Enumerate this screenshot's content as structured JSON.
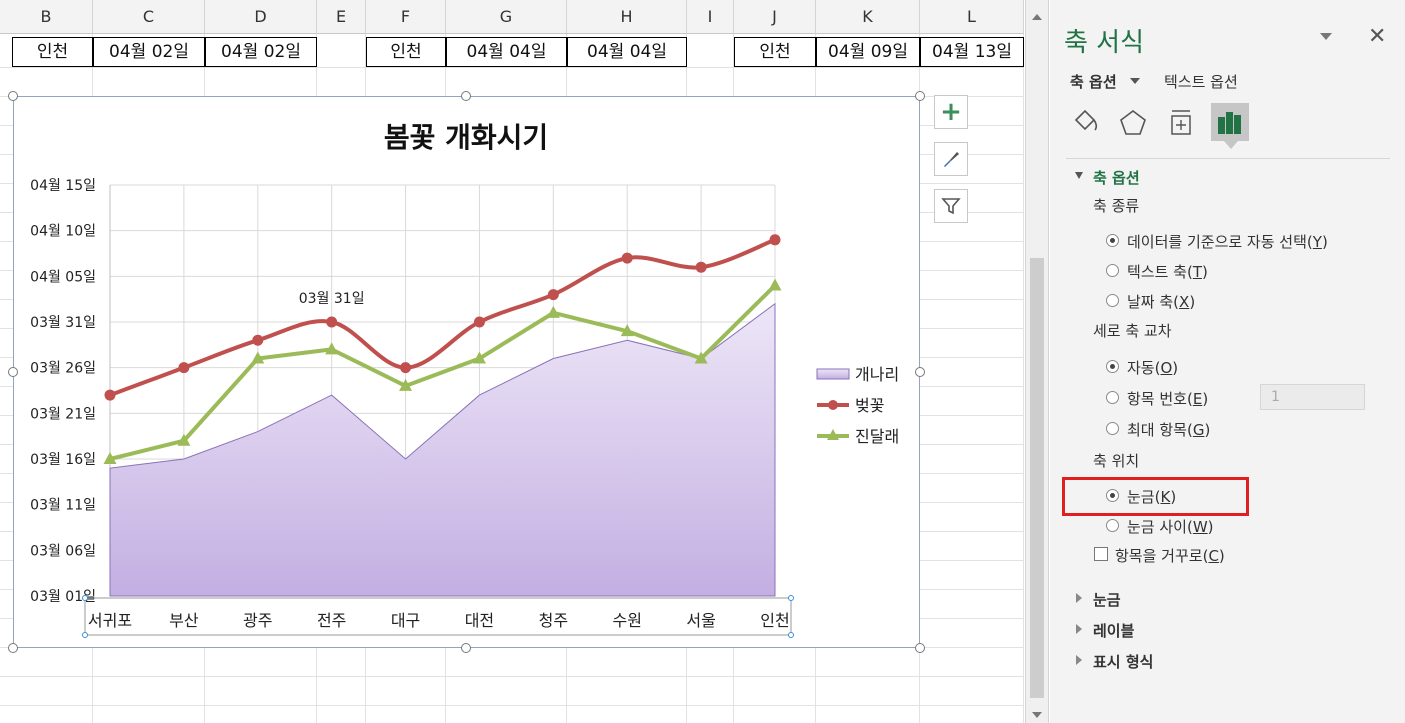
{
  "sheet": {
    "columns": [
      "B",
      "C",
      "D",
      "E",
      "F",
      "G",
      "H",
      "I",
      "J",
      "K",
      "L"
    ],
    "row_cells": [
      "인천",
      "04월 02일",
      "04월 02일",
      "",
      "인천",
      "04월 04일",
      "04월 04일",
      "",
      "인천",
      "04월 09일",
      "04월 13일"
    ]
  },
  "chart_data": {
    "type": "line",
    "title": "봄꽃 개화시기",
    "categories": [
      "서귀포",
      "부산",
      "광주",
      "전주",
      "대구",
      "대전",
      "청주",
      "수원",
      "서울",
      "인천"
    ],
    "y_tick_labels": [
      "04월 15일",
      "04월 10일",
      "04월 05일",
      "03월 31일",
      "03월 26일",
      "03월 21일",
      "03월 16일",
      "03월 11일",
      "03월 06일",
      "03월 01일"
    ],
    "ylim_day_of_march": [
      1,
      46
    ],
    "series": [
      {
        "name": "개나리",
        "kind": "area",
        "values_day_of_march": [
          15,
          16,
          19,
          23,
          16,
          23,
          27,
          29,
          27,
          33
        ],
        "color": "#c6b4e4"
      },
      {
        "name": "벚꽃",
        "kind": "line",
        "marker": "circle",
        "values_day_of_march": [
          23,
          26,
          29,
          31,
          26,
          31,
          34,
          38,
          37,
          40
        ],
        "color": "#c0504d"
      },
      {
        "name": "진달래",
        "kind": "line",
        "marker": "triangle",
        "values_day_of_march": [
          16,
          18,
          27,
          28,
          24,
          27,
          32,
          30,
          27,
          35
        ],
        "color": "#9bbb59"
      }
    ],
    "data_label": {
      "series": "벚꽃",
      "index": 3,
      "text": "03월 31일"
    },
    "grid": true,
    "legend": "right"
  },
  "pane": {
    "title": "축 서식",
    "tab_axis_options": "축 옵션",
    "tab_text_options": "텍스트 옵션",
    "section_axis_options": "축 옵션",
    "axis_type": {
      "label": "축 종류",
      "options": [
        {
          "text": "데이터를 기준으로 자동 선택",
          "key": "Y",
          "selected": true
        },
        {
          "text": "텍스트 축",
          "key": "T",
          "selected": false
        },
        {
          "text": "날짜 축",
          "key": "X",
          "selected": false
        }
      ]
    },
    "vertical_cross": {
      "label": "세로 축 교차",
      "options": [
        {
          "text": "자동",
          "key": "O",
          "selected": true
        },
        {
          "text": "항목 번호",
          "key": "E",
          "selected": false
        },
        {
          "text": "최대 항목",
          "key": "G",
          "selected": false
        }
      ],
      "item_number_value": "1"
    },
    "axis_position": {
      "label": "축 위치",
      "options": [
        {
          "text": "눈금",
          "key": "K",
          "selected": true
        },
        {
          "text": "눈금 사이",
          "key": "W",
          "selected": false
        }
      ],
      "reverse_checkbox": {
        "text": "항목을 거꾸로",
        "key": "C",
        "checked": false
      }
    },
    "collapsed_sections": [
      "눈금",
      "레이블",
      "표시 형식"
    ],
    "highlight_color": "#e02020",
    "accent_color": "#217346"
  }
}
